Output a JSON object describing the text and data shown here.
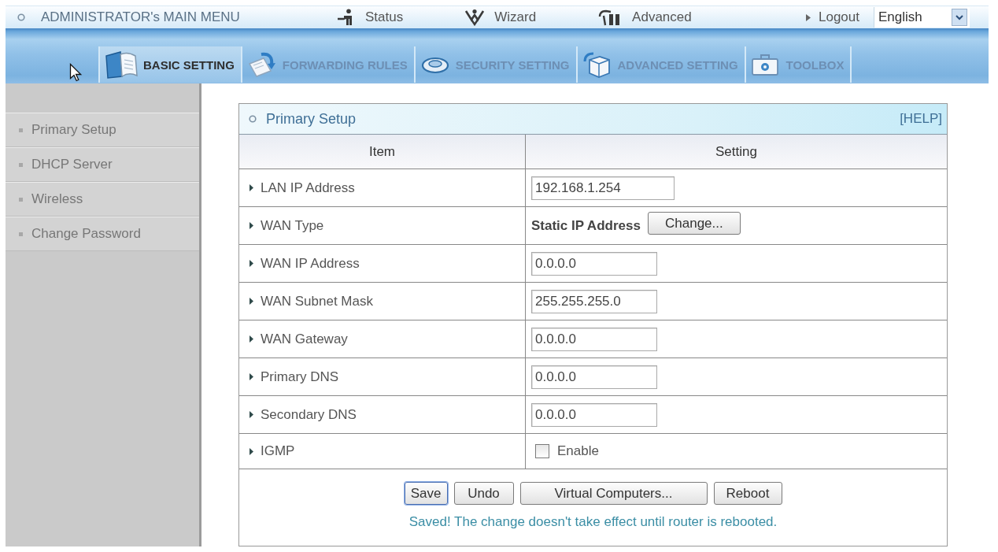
{
  "top_menu": {
    "title": "ADMINISTRATOR's MAIN MENU",
    "links": [
      {
        "label": "Status",
        "kind": "status"
      },
      {
        "label": "Wizard",
        "kind": "wizard"
      },
      {
        "label": "Advanced",
        "kind": "advanced"
      },
      {
        "label": "Logout",
        "kind": "logout"
      }
    ],
    "language": "English"
  },
  "tabs": [
    {
      "label": "BASIC SETTING",
      "selected": true,
      "kind": "folder"
    },
    {
      "label": "FORWARDING RULES",
      "selected": false,
      "kind": "document"
    },
    {
      "label": "SECURITY SETTING",
      "selected": false,
      "kind": "disc"
    },
    {
      "label": "ADVANCED SETTING",
      "selected": false,
      "kind": "box"
    },
    {
      "label": "TOOLBOX",
      "selected": false,
      "kind": "toolbox"
    }
  ],
  "sidebar": {
    "items": [
      {
        "label": "Primary Setup"
      },
      {
        "label": "DHCP Server"
      },
      {
        "label": "Wireless"
      },
      {
        "label": "Change Password"
      }
    ]
  },
  "panel": {
    "title": "Primary Setup",
    "help": "[HELP]",
    "columns": [
      "Item",
      "Setting"
    ],
    "rows": [
      {
        "label": "LAN IP Address",
        "kind": "input",
        "value": "192.168.1.254"
      },
      {
        "label": "WAN Type",
        "kind": "choice",
        "text": "Static IP Address",
        "button": "Change..."
      },
      {
        "label": "WAN IP Address",
        "kind": "input",
        "value": "0.0.0.0"
      },
      {
        "label": "WAN Subnet Mask",
        "kind": "input",
        "value": "255.255.255.0"
      },
      {
        "label": "WAN Gateway",
        "kind": "input",
        "value": "0.0.0.0"
      },
      {
        "label": "Primary DNS",
        "kind": "input",
        "value": "0.0.0.0"
      },
      {
        "label": "Secondary DNS",
        "kind": "input",
        "value": "0.0.0.0"
      },
      {
        "label": "IGMP",
        "kind": "checkbox",
        "option": "Enable",
        "checked": false
      }
    ],
    "buttons": [
      {
        "label": "Save",
        "focused": true
      },
      {
        "label": "Undo",
        "focused": false
      },
      {
        "label": "Virtual Computers...",
        "focused": false
      },
      {
        "label": "Reboot",
        "focused": false
      }
    ],
    "message": "Saved! The change doesn't take effect until router is rebooted."
  }
}
